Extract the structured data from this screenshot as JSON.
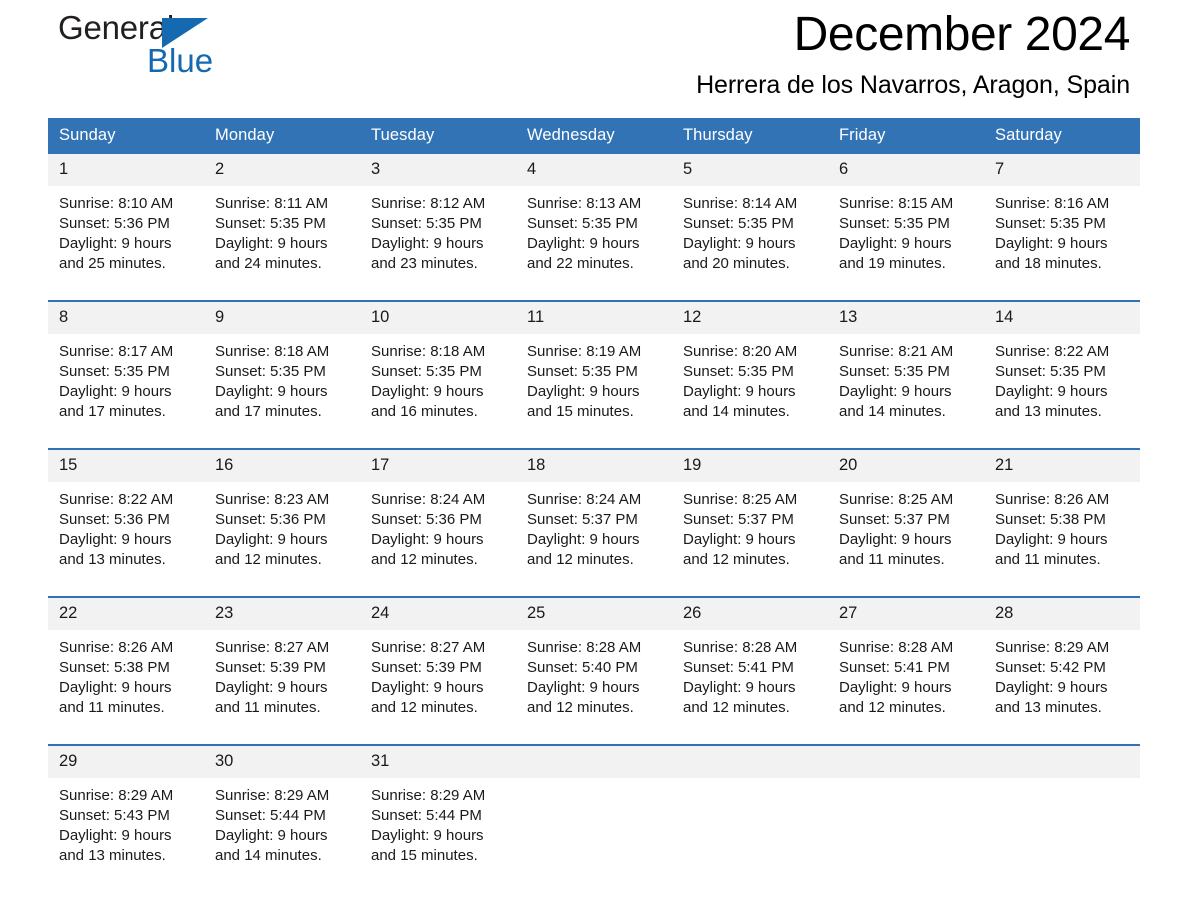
{
  "brand": {
    "name_part1": "General",
    "name_part2": "Blue",
    "logo_icon": "triangle-icon",
    "accent_color": "#1569b0"
  },
  "header": {
    "title": "December 2024",
    "subtitle": "Herrera de los Navarros, Aragon, Spain"
  },
  "theme": {
    "header_blue": "#3273b5",
    "row_divider_blue": "#2e74b5",
    "daynum_band": "#f2f2f2"
  },
  "calendar": {
    "weekday_headers": [
      "Sunday",
      "Monday",
      "Tuesday",
      "Wednesday",
      "Thursday",
      "Friday",
      "Saturday"
    ],
    "weeks": [
      [
        {
          "day": "1",
          "sunrise": "Sunrise: 8:10 AM",
          "sunset": "Sunset: 5:36 PM",
          "daylight_line1": "Daylight: 9 hours",
          "daylight_line2": "and 25 minutes."
        },
        {
          "day": "2",
          "sunrise": "Sunrise: 8:11 AM",
          "sunset": "Sunset: 5:35 PM",
          "daylight_line1": "Daylight: 9 hours",
          "daylight_line2": "and 24 minutes."
        },
        {
          "day": "3",
          "sunrise": "Sunrise: 8:12 AM",
          "sunset": "Sunset: 5:35 PM",
          "daylight_line1": "Daylight: 9 hours",
          "daylight_line2": "and 23 minutes."
        },
        {
          "day": "4",
          "sunrise": "Sunrise: 8:13 AM",
          "sunset": "Sunset: 5:35 PM",
          "daylight_line1": "Daylight: 9 hours",
          "daylight_line2": "and 22 minutes."
        },
        {
          "day": "5",
          "sunrise": "Sunrise: 8:14 AM",
          "sunset": "Sunset: 5:35 PM",
          "daylight_line1": "Daylight: 9 hours",
          "daylight_line2": "and 20 minutes."
        },
        {
          "day": "6",
          "sunrise": "Sunrise: 8:15 AM",
          "sunset": "Sunset: 5:35 PM",
          "daylight_line1": "Daylight: 9 hours",
          "daylight_line2": "and 19 minutes."
        },
        {
          "day": "7",
          "sunrise": "Sunrise: 8:16 AM",
          "sunset": "Sunset: 5:35 PM",
          "daylight_line1": "Daylight: 9 hours",
          "daylight_line2": "and 18 minutes."
        }
      ],
      [
        {
          "day": "8",
          "sunrise": "Sunrise: 8:17 AM",
          "sunset": "Sunset: 5:35 PM",
          "daylight_line1": "Daylight: 9 hours",
          "daylight_line2": "and 17 minutes."
        },
        {
          "day": "9",
          "sunrise": "Sunrise: 8:18 AM",
          "sunset": "Sunset: 5:35 PM",
          "daylight_line1": "Daylight: 9 hours",
          "daylight_line2": "and 17 minutes."
        },
        {
          "day": "10",
          "sunrise": "Sunrise: 8:18 AM",
          "sunset": "Sunset: 5:35 PM",
          "daylight_line1": "Daylight: 9 hours",
          "daylight_line2": "and 16 minutes."
        },
        {
          "day": "11",
          "sunrise": "Sunrise: 8:19 AM",
          "sunset": "Sunset: 5:35 PM",
          "daylight_line1": "Daylight: 9 hours",
          "daylight_line2": "and 15 minutes."
        },
        {
          "day": "12",
          "sunrise": "Sunrise: 8:20 AM",
          "sunset": "Sunset: 5:35 PM",
          "daylight_line1": "Daylight: 9 hours",
          "daylight_line2": "and 14 minutes."
        },
        {
          "day": "13",
          "sunrise": "Sunrise: 8:21 AM",
          "sunset": "Sunset: 5:35 PM",
          "daylight_line1": "Daylight: 9 hours",
          "daylight_line2": "and 14 minutes."
        },
        {
          "day": "14",
          "sunrise": "Sunrise: 8:22 AM",
          "sunset": "Sunset: 5:35 PM",
          "daylight_line1": "Daylight: 9 hours",
          "daylight_line2": "and 13 minutes."
        }
      ],
      [
        {
          "day": "15",
          "sunrise": "Sunrise: 8:22 AM",
          "sunset": "Sunset: 5:36 PM",
          "daylight_line1": "Daylight: 9 hours",
          "daylight_line2": "and 13 minutes."
        },
        {
          "day": "16",
          "sunrise": "Sunrise: 8:23 AM",
          "sunset": "Sunset: 5:36 PM",
          "daylight_line1": "Daylight: 9 hours",
          "daylight_line2": "and 12 minutes."
        },
        {
          "day": "17",
          "sunrise": "Sunrise: 8:24 AM",
          "sunset": "Sunset: 5:36 PM",
          "daylight_line1": "Daylight: 9 hours",
          "daylight_line2": "and 12 minutes."
        },
        {
          "day": "18",
          "sunrise": "Sunrise: 8:24 AM",
          "sunset": "Sunset: 5:37 PM",
          "daylight_line1": "Daylight: 9 hours",
          "daylight_line2": "and 12 minutes."
        },
        {
          "day": "19",
          "sunrise": "Sunrise: 8:25 AM",
          "sunset": "Sunset: 5:37 PM",
          "daylight_line1": "Daylight: 9 hours",
          "daylight_line2": "and 12 minutes."
        },
        {
          "day": "20",
          "sunrise": "Sunrise: 8:25 AM",
          "sunset": "Sunset: 5:37 PM",
          "daylight_line1": "Daylight: 9 hours",
          "daylight_line2": "and 11 minutes."
        },
        {
          "day": "21",
          "sunrise": "Sunrise: 8:26 AM",
          "sunset": "Sunset: 5:38 PM",
          "daylight_line1": "Daylight: 9 hours",
          "daylight_line2": "and 11 minutes."
        }
      ],
      [
        {
          "day": "22",
          "sunrise": "Sunrise: 8:26 AM",
          "sunset": "Sunset: 5:38 PM",
          "daylight_line1": "Daylight: 9 hours",
          "daylight_line2": "and 11 minutes."
        },
        {
          "day": "23",
          "sunrise": "Sunrise: 8:27 AM",
          "sunset": "Sunset: 5:39 PM",
          "daylight_line1": "Daylight: 9 hours",
          "daylight_line2": "and 11 minutes."
        },
        {
          "day": "24",
          "sunrise": "Sunrise: 8:27 AM",
          "sunset": "Sunset: 5:39 PM",
          "daylight_line1": "Daylight: 9 hours",
          "daylight_line2": "and 12 minutes."
        },
        {
          "day": "25",
          "sunrise": "Sunrise: 8:28 AM",
          "sunset": "Sunset: 5:40 PM",
          "daylight_line1": "Daylight: 9 hours",
          "daylight_line2": "and 12 minutes."
        },
        {
          "day": "26",
          "sunrise": "Sunrise: 8:28 AM",
          "sunset": "Sunset: 5:41 PM",
          "daylight_line1": "Daylight: 9 hours",
          "daylight_line2": "and 12 minutes."
        },
        {
          "day": "27",
          "sunrise": "Sunrise: 8:28 AM",
          "sunset": "Sunset: 5:41 PM",
          "daylight_line1": "Daylight: 9 hours",
          "daylight_line2": "and 12 minutes."
        },
        {
          "day": "28",
          "sunrise": "Sunrise: 8:29 AM",
          "sunset": "Sunset: 5:42 PM",
          "daylight_line1": "Daylight: 9 hours",
          "daylight_line2": "and 13 minutes."
        }
      ],
      [
        {
          "day": "29",
          "sunrise": "Sunrise: 8:29 AM",
          "sunset": "Sunset: 5:43 PM",
          "daylight_line1": "Daylight: 9 hours",
          "daylight_line2": "and 13 minutes."
        },
        {
          "day": "30",
          "sunrise": "Sunrise: 8:29 AM",
          "sunset": "Sunset: 5:44 PM",
          "daylight_line1": "Daylight: 9 hours",
          "daylight_line2": "and 14 minutes."
        },
        {
          "day": "31",
          "sunrise": "Sunrise: 8:29 AM",
          "sunset": "Sunset: 5:44 PM",
          "daylight_line1": "Daylight: 9 hours",
          "daylight_line2": "and 15 minutes."
        },
        {
          "day": "",
          "sunrise": "",
          "sunset": "",
          "daylight_line1": "",
          "daylight_line2": ""
        },
        {
          "day": "",
          "sunrise": "",
          "sunset": "",
          "daylight_line1": "",
          "daylight_line2": ""
        },
        {
          "day": "",
          "sunrise": "",
          "sunset": "",
          "daylight_line1": "",
          "daylight_line2": ""
        },
        {
          "day": "",
          "sunrise": "",
          "sunset": "",
          "daylight_line1": "",
          "daylight_line2": ""
        }
      ]
    ]
  }
}
